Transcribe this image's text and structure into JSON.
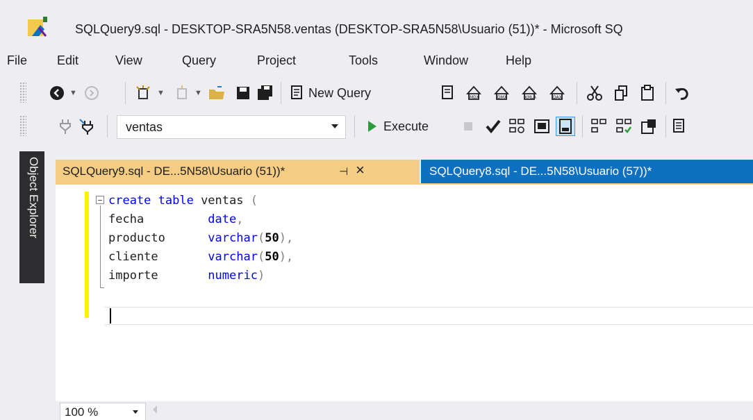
{
  "window": {
    "title": "SQLQuery9.sql - DESKTOP-SRA5N58.ventas (DESKTOP-SRA5N58\\Usuario (51))* - Microsoft SQ"
  },
  "menu": {
    "items": [
      "File",
      "Edit",
      "View",
      "Query",
      "Project",
      "Tools",
      "Window",
      "Help"
    ]
  },
  "toolbar1": {
    "new_query_label": "New Query",
    "icons": [
      "back-icon",
      "forward-icon",
      "new-project-icon",
      "new-file-icon",
      "open-folder-icon",
      "save-icon",
      "save-all-icon",
      "new-query-icon",
      "mdx-query-icon",
      "dmx-query-icon",
      "xmla-query-icon",
      "dax-query-icon",
      "cut-icon",
      "copy-icon",
      "paste-icon",
      "undo-icon"
    ]
  },
  "toolbar2": {
    "database": "ventas",
    "execute_label": "Execute"
  },
  "sidebar": {
    "object_explorer_label": "Object Explorer"
  },
  "tabs": [
    {
      "label": "SQLQuery9.sql - DE...5N58\\Usuario (51))*",
      "active": true
    },
    {
      "label": "SQLQuery8.sql - DE...5N58\\Usuario (57))*",
      "active": false
    }
  ],
  "editor": {
    "lines": [
      [
        {
          "t": "create table ",
          "c": "kw"
        },
        {
          "t": "ventas ",
          "c": ""
        },
        {
          "t": "(",
          "c": "gr"
        }
      ],
      [
        {
          "t": "fecha         ",
          "c": ""
        },
        {
          "t": "date",
          "c": "tp"
        },
        {
          "t": ",",
          "c": "gr"
        }
      ],
      [
        {
          "t": "producto      ",
          "c": ""
        },
        {
          "t": "varchar",
          "c": "tp"
        },
        {
          "t": "(",
          "c": "gr"
        },
        {
          "t": "50",
          "c": "num"
        },
        {
          "t": "),",
          "c": "gr"
        }
      ],
      [
        {
          "t": "cliente       ",
          "c": ""
        },
        {
          "t": "varchar",
          "c": "tp"
        },
        {
          "t": "(",
          "c": "gr"
        },
        {
          "t": "50",
          "c": "num"
        },
        {
          "t": "),",
          "c": "gr"
        }
      ],
      [
        {
          "t": "importe       ",
          "c": ""
        },
        {
          "t": "numeric",
          "c": "tp"
        },
        {
          "t": ")",
          "c": "gr"
        }
      ]
    ]
  },
  "status": {
    "zoom": "100 %"
  }
}
